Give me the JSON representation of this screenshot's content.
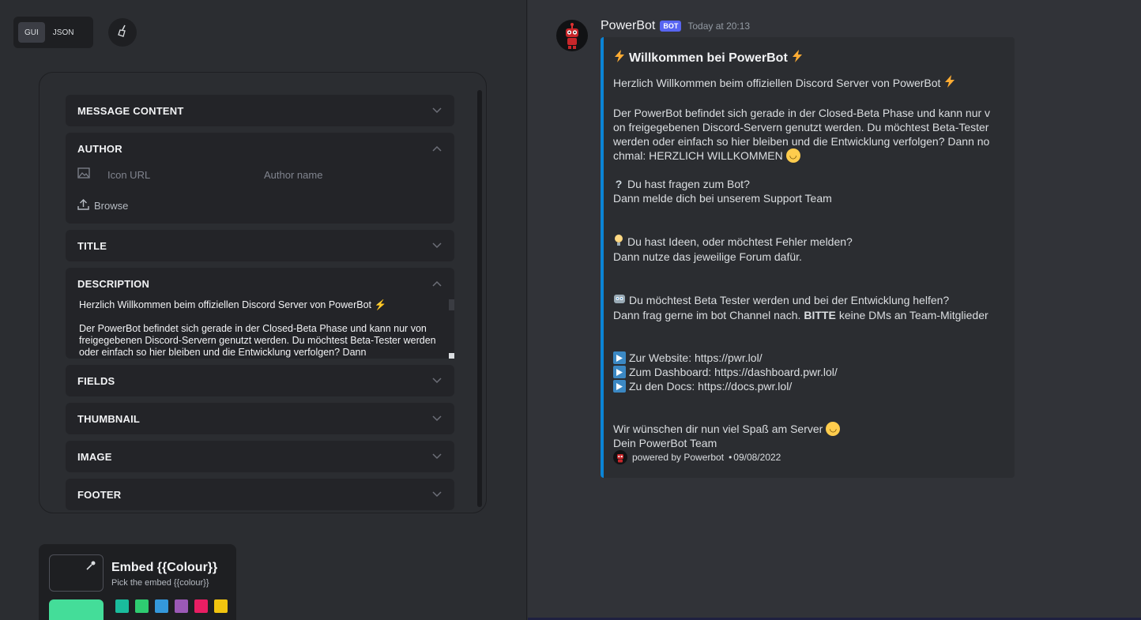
{
  "left": {
    "mode_toggle": {
      "gui": "GUI",
      "json": "JSON"
    },
    "sections": {
      "message_content": "MESSAGE CONTENT",
      "author": "AUTHOR",
      "title": "TITLE",
      "description": "DESCRIPTION",
      "fields": "FIELDS",
      "thumbnail": "THUMBNAIL",
      "image": "IMAGE",
      "footer": "FOOTER"
    },
    "author": {
      "icon_url_placeholder": "Icon URL",
      "author_name_placeholder": "Author name",
      "browse": "Browse"
    },
    "description_text": "Herzlich Willkommen beim offiziellen Discord Server von PowerBot ⚡\n\nDer PowerBot befindet sich gerade in der Closed-Beta Phase und kann nur von freigegebenen Discord-Servern genutzt werden. Du möchtest Beta-Tester werden oder einfach so hier bleiben und die Entwicklung verfolgen? Dann",
    "colour": {
      "title": "Embed {{Colour}}",
      "subtitle": "Pick the embed {{colour}}",
      "active": "#44dd99",
      "swatches": [
        "#1abc9c",
        "#2ecc71",
        "#3498db",
        "#9b59b6",
        "#e91e63",
        "#f1c40f"
      ]
    }
  },
  "preview": {
    "bot_name": "PowerBot",
    "badge": "BOT",
    "timestamp": "Today at 20:13",
    "embed_color": "#0a84d6",
    "title": "Willkommen bei PowerBot",
    "lines": {
      "l1": "Herzlich Willkommen beim offiziellen Discord Server von PowerBot",
      "l2": "Der PowerBot befindet sich gerade in der Closed-Beta Phase und kann nur v",
      "l3": "on freigegebenen Discord-Servern genutzt werden. Du möchtest Beta-Tester",
      "l4": "werden oder einfach so hier bleiben und die Entwicklung verfolgen? Dann no",
      "l5": "chmal: HERZLICH WILLKOMMEN",
      "l6": "Du hast fragen zum Bot?",
      "l7": "Dann melde dich bei unserem Support Team",
      "l8": "Du hast Ideen, oder möchtest Fehler melden?",
      "l9": "Dann nutze das jeweilige Forum dafür.",
      "l10": "Du möchtest Beta Tester werden und bei der Entwicklung helfen?",
      "l11a": "Dann frag gerne im bot Channel nach.",
      "l11b": "BITTE",
      "l11c": "keine DMs an Team-Mitglieder",
      "l12": "Zur Website: https://pwr.lol/",
      "l13": "Zum Dashboard: https://dashboard.pwr.lol/",
      "l14": "Zu den Docs: https://docs.pwr.lol/",
      "l15": "Wir wünschen dir nun viel Spaß am Server",
      "l16": "Dein PowerBot Team"
    },
    "footer_text": "powered by Powerbot",
    "footer_date": "09/08/2022"
  }
}
